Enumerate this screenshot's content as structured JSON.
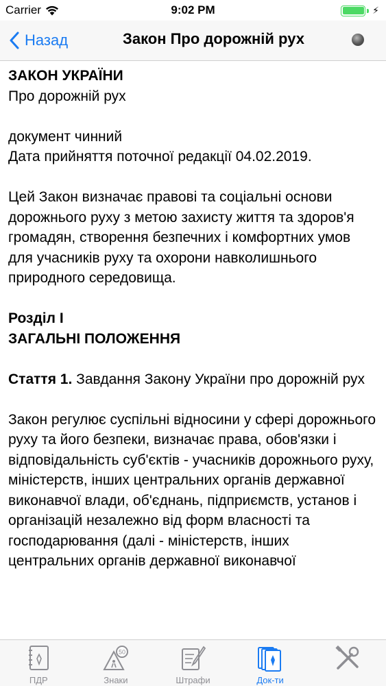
{
  "status_bar": {
    "carrier": "Carrier",
    "time": "9:02 PM"
  },
  "nav": {
    "back_label": "Назад",
    "title": "Закон Про дорожній рух"
  },
  "document": {
    "law_heading": "ЗАКОН УКРАЇНИ",
    "law_subtitle": "Про дорожній рух",
    "status": "документ чинний",
    "edition_date": "Дата прийняття поточної редакції 04.02.2019.",
    "preamble": "Цей Закон визначає правові та соціальні основи дорожнього руху з метою захисту життя та здоров'я громадян, створення безпечних і комфортних умов для учасників руху та охорони навколишнього природного середовища.",
    "section_number": "Розділ I",
    "section_title": "ЗАГАЛЬНІ ПОЛОЖЕННЯ",
    "article_label": "Стаття 1.",
    "article_title": " Завдання Закону України про дорожній рух",
    "article_body": "Закон регулює суспільні відносини у сфері дорожнього руху та його безпеки, визначає права, обов'язки і відповідальність суб'єктів - учасників дорожнього руху, міністерств, інших центральних органів державної виконавчої влади, об'єднань, підприємств, установ і організацій незалежно від форм власності та господарювання (далі - міністерств, інших центральних органів державної виконавчої"
  },
  "tabs": [
    {
      "label": "ПДР",
      "icon": "rulebook-icon",
      "active": false
    },
    {
      "label": "Знаки",
      "icon": "road-signs-icon",
      "active": false
    },
    {
      "label": "Штрафи",
      "icon": "fines-icon",
      "active": false
    },
    {
      "label": "Док-ти",
      "icon": "documents-icon",
      "active": true
    },
    {
      "label": "",
      "icon": "tools-icon",
      "active": false
    }
  ],
  "colors": {
    "accent": "#1a7bf2",
    "inactive": "#8e8e93",
    "battery": "#4cd964"
  }
}
